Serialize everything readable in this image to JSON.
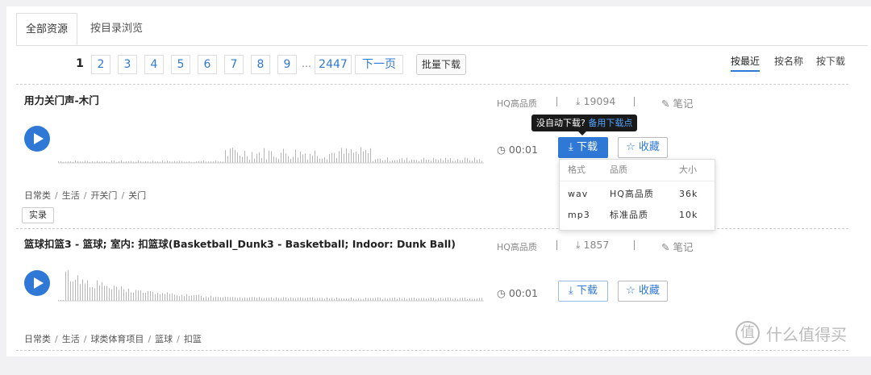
{
  "tabs": [
    "全部资源",
    "按目录浏览"
  ],
  "pagination": {
    "current": "1",
    "pages": [
      "2",
      "3",
      "4",
      "5",
      "6",
      "7",
      "8",
      "9"
    ],
    "ellipsis": "…",
    "last": "2447",
    "next": "下一页"
  },
  "batch_download": "批量下载",
  "sort": [
    "按最近",
    "按名称",
    "按下载"
  ],
  "items": [
    {
      "title": "用力关门声-木门",
      "quality": "HQ高品质",
      "downloads": "19094",
      "note": "笔记",
      "duration": "00:01",
      "download_label": "下载",
      "fav_label": "收藏",
      "crumbs": [
        "日常类",
        "生活",
        "开关门",
        "关门"
      ],
      "tag": "实录"
    },
    {
      "title": "篮球扣篮3 - 篮球; 室内: 扣篮球(Basketball_Dunk3 - Basketball; Indoor: Dunk Ball)",
      "quality": "HQ高品质",
      "downloads": "1857",
      "note": "笔记",
      "duration": "00:01",
      "download_label": "下载",
      "fav_label": "收藏",
      "crumbs": [
        "日常类",
        "生活",
        "球类体育项目",
        "篮球",
        "扣篮"
      ]
    }
  ],
  "tooltip": {
    "text": "没自动下载?",
    "link": "备用下载点"
  },
  "dropdown": {
    "headers": [
      "格式",
      "品质",
      "大小"
    ],
    "rows": [
      [
        "wav",
        "HQ高品质",
        "36k"
      ],
      [
        "mp3",
        "标准品质",
        "10k"
      ]
    ]
  },
  "watermark": {
    "logo": "值",
    "text": "什么值得买"
  },
  "colors": {
    "accent": "#2f78d6",
    "background": "#f1f1f3"
  }
}
